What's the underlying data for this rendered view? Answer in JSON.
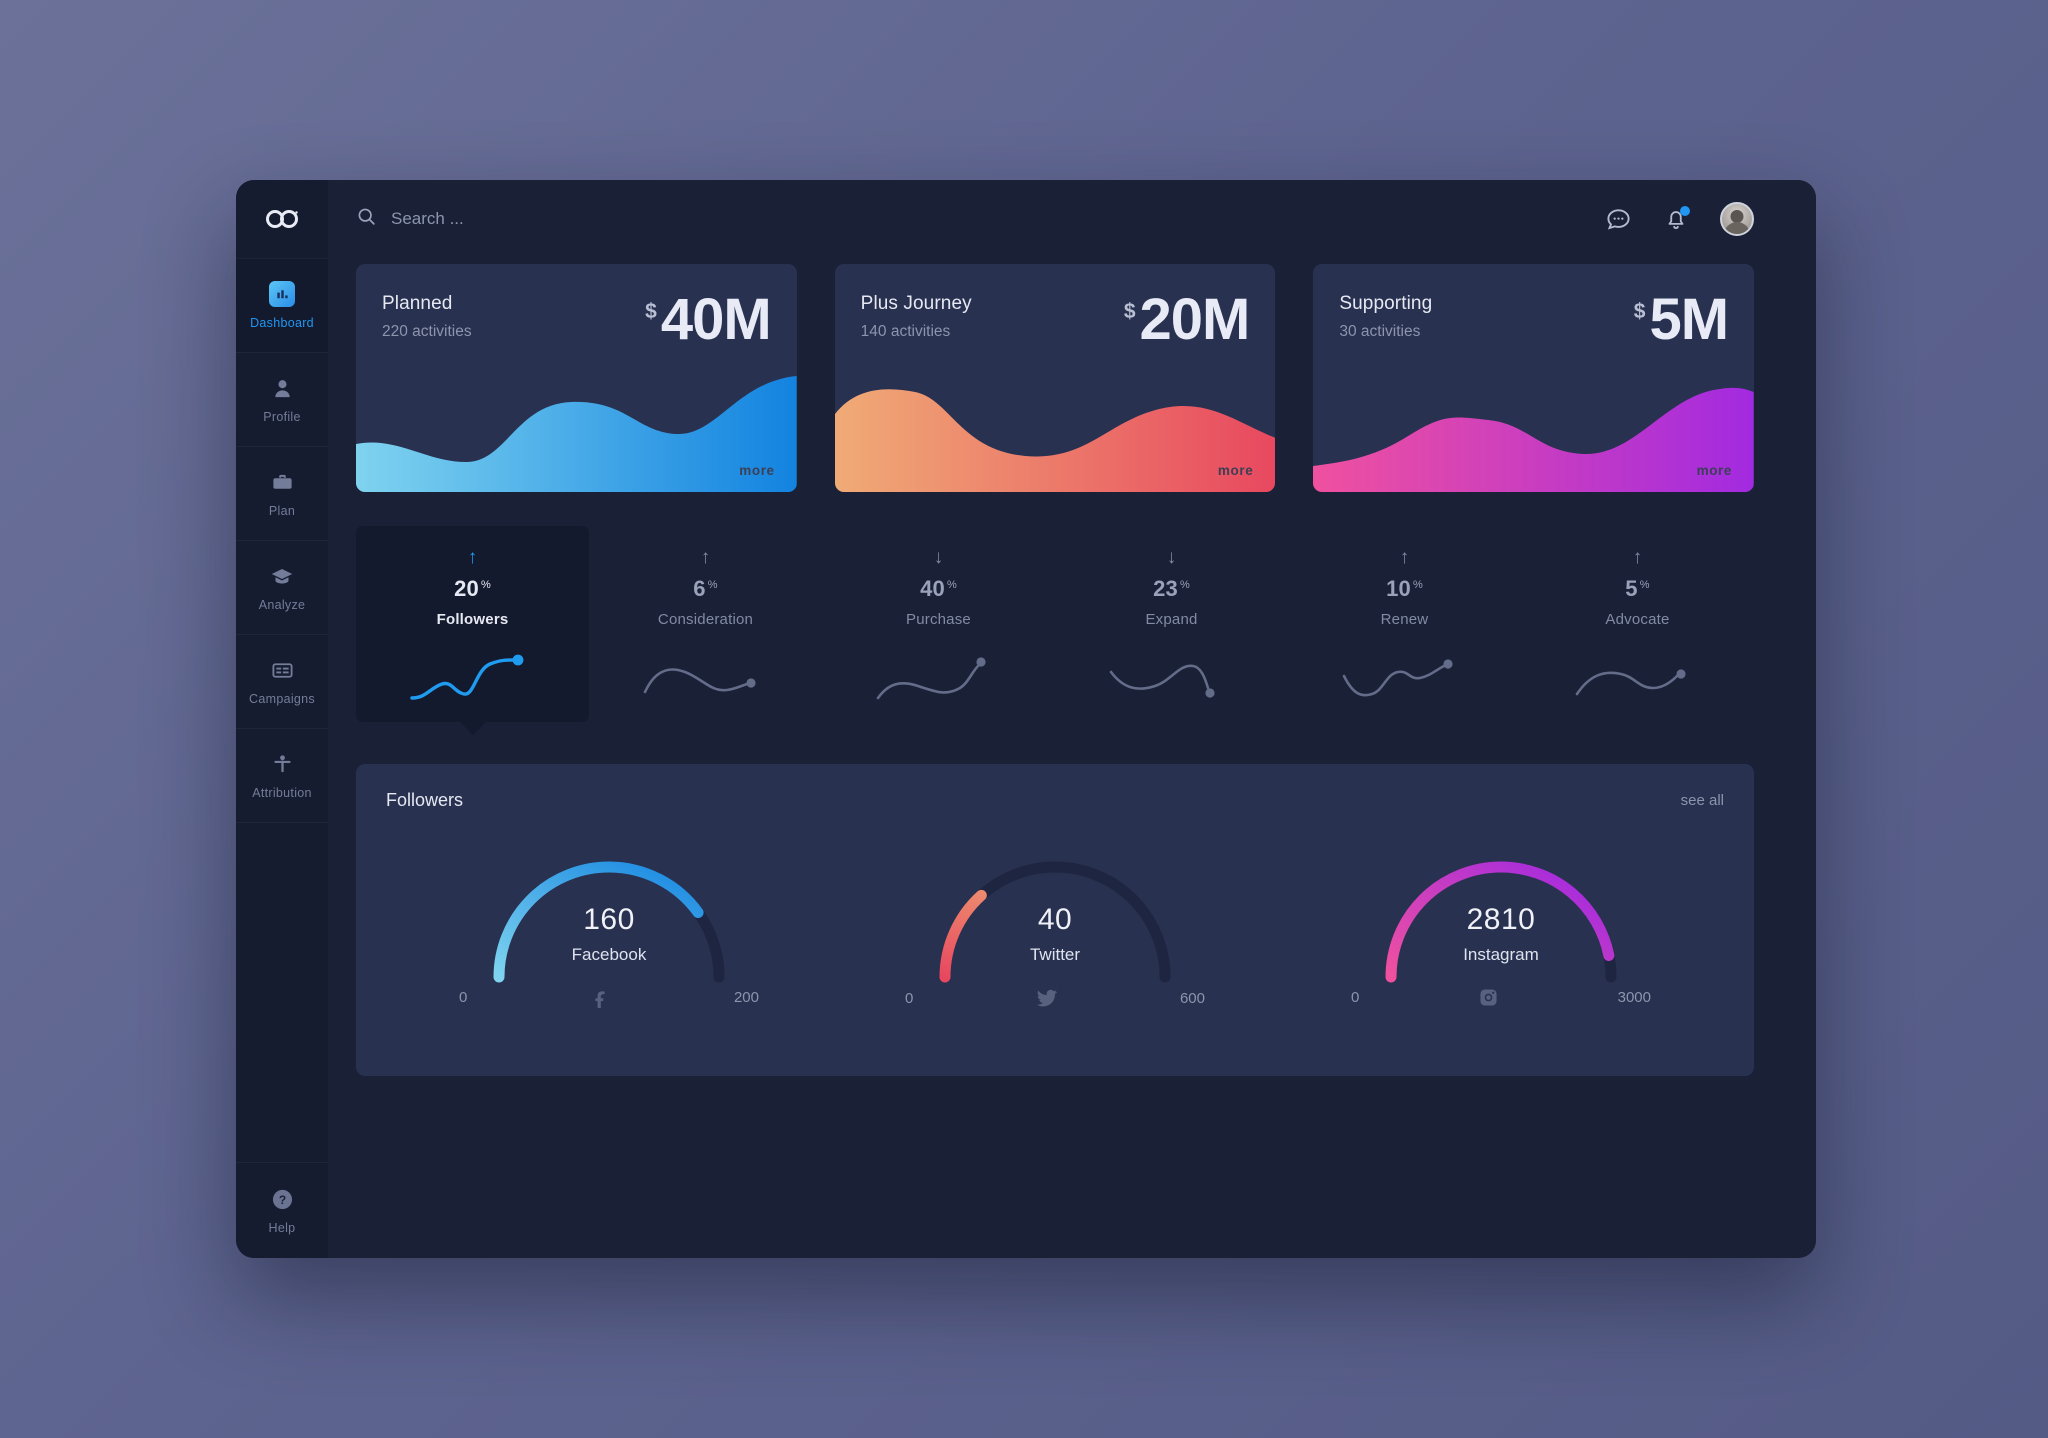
{
  "app": {
    "logo": "infinity-logo"
  },
  "sidebar": {
    "items": [
      {
        "label": "Dashboard",
        "icon": "bar-chart-icon",
        "active": true
      },
      {
        "label": "Profile",
        "icon": "user-icon",
        "active": false
      },
      {
        "label": "Plan",
        "icon": "briefcase-icon",
        "active": false
      },
      {
        "label": "Analyze",
        "icon": "graduation-cap-icon",
        "active": false
      },
      {
        "label": "Campaigns",
        "icon": "list-card-icon",
        "active": false
      },
      {
        "label": "Attribution",
        "icon": "person-arms-icon",
        "active": false
      }
    ],
    "help": {
      "label": "Help",
      "icon": "question-circle-icon"
    }
  },
  "topbar": {
    "search": {
      "placeholder": "Search ...",
      "value": "",
      "icon": "search-icon"
    },
    "messages_icon": "chat-bubble-icon",
    "notifications_icon": "bell-icon",
    "has_notification": true,
    "avatar": "user-avatar"
  },
  "kpi_cards": [
    {
      "title": "Planned",
      "subtitle": "220 activities",
      "currency": "$",
      "value": "40M",
      "more_label": "more",
      "color_start": "#7fd3ef",
      "color_end": "#1283e0"
    },
    {
      "title": "Plus Journey",
      "subtitle": "140 activities",
      "currency": "$",
      "value": "20M",
      "more_label": "more",
      "color_start": "#f0ab76",
      "color_end": "#e8485f"
    },
    {
      "title": "Supporting",
      "subtitle": "30 activities",
      "currency": "$",
      "value": "5M",
      "more_label": "more",
      "color_start": "#f0519f",
      "color_end": "#a22ae0"
    }
  ],
  "funnel": [
    {
      "value": "20",
      "unit": "%",
      "label": "Followers",
      "direction": "up",
      "arrow": "↑",
      "active": true
    },
    {
      "value": "6",
      "unit": "%",
      "label": "Consideration",
      "direction": "up",
      "arrow": "↑",
      "active": false
    },
    {
      "value": "40",
      "unit": "%",
      "label": "Purchase",
      "direction": "down",
      "arrow": "↓",
      "active": false
    },
    {
      "value": "23",
      "unit": "%",
      "label": "Expand",
      "direction": "down",
      "arrow": "↓",
      "active": false
    },
    {
      "value": "10",
      "unit": "%",
      "label": "Renew",
      "direction": "up",
      "arrow": "↑",
      "active": false
    },
    {
      "value": "5",
      "unit": "%",
      "label": "Advocate",
      "direction": "up",
      "arrow": "↑",
      "active": false
    }
  ],
  "followers_panel": {
    "title": "Followers",
    "see_all_label": "see all"
  },
  "chart_data": {
    "type": "gauge",
    "title": "Followers",
    "gauges": [
      {
        "name": "Facebook",
        "value": 160,
        "min": 0,
        "max": 200,
        "min_label": "0",
        "max_label": "200",
        "icon": "facebook-icon",
        "color_start": "#7fd3ef",
        "color_end": "#1283e0",
        "track_color": "#1e2540"
      },
      {
        "name": "Twitter",
        "value": 40,
        "min": 0,
        "max": 600,
        "min_label": "0",
        "max_label": "600",
        "icon": "twitter-icon",
        "color_start": "#e8485f",
        "color_end": "#f0ab76",
        "track_color": "#1e2540"
      },
      {
        "name": "Instagram",
        "value": 2810,
        "min": 0,
        "max": 3000,
        "min_label": "0",
        "max_label": "3000",
        "icon": "instagram-icon",
        "color_start": "#f0519f",
        "color_end": "#a22ae0",
        "track_color": "#1e2540"
      }
    ]
  }
}
